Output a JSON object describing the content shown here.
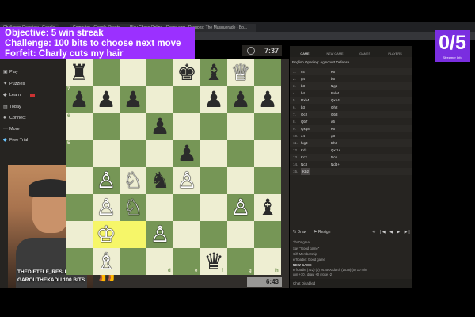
{
  "browser": {
    "tabs": [
      "Challenge Overview - Google",
      "Computer - Google Sheets",
      "Play Chess Online - Chess.com",
      "Dragons: The Masquerade - Bo..."
    ]
  },
  "overlay": {
    "objective": "Objective: 5 win streak",
    "challenge": "Challenge: 100 bits to choose next move",
    "forfeit": "Forfeit: Charly cuts my hair",
    "score": "0/5",
    "score_sub": "Streamer Info"
  },
  "sidebar": {
    "items": [
      {
        "label": "Play",
        "icon": "play-icon"
      },
      {
        "label": "Puzzles",
        "icon": "puzzle-icon"
      },
      {
        "label": "Learn",
        "icon": "learn-icon"
      },
      {
        "label": "Today",
        "icon": "today-icon"
      },
      {
        "label": "Connect",
        "icon": "connect-icon"
      },
      {
        "label": "More",
        "icon": "more-icon"
      },
      {
        "label": "Free Trial",
        "icon": "diamond-icon"
      }
    ]
  },
  "board": {
    "ranks": [
      "7",
      "6",
      "5"
    ],
    "files": [
      "d",
      "e",
      "f",
      "g",
      "h"
    ],
    "clock_top": "7:37",
    "clock_bottom": "6:43"
  },
  "panel": {
    "tabs": [
      "GAME",
      "NEW GAME",
      "GAMES",
      "PLAYERS"
    ],
    "opening": "English Opening: Agincourt Defense",
    "moves": [
      [
        "1.",
        "c4",
        "e6"
      ],
      [
        "2.",
        "g4",
        "b5"
      ],
      [
        "3.",
        "b3",
        "Ng6"
      ],
      [
        "4.",
        "h4",
        "Bxh4"
      ],
      [
        "5.",
        "Rxh4",
        "Qxh4"
      ],
      [
        "6.",
        "b3",
        "Qh2"
      ],
      [
        "7.",
        "Qc2",
        "Qb3"
      ],
      [
        "8.",
        "Qb7",
        "d6"
      ],
      [
        "9.",
        "Qxg8",
        "e6"
      ],
      [
        "10.",
        "e4",
        "g3"
      ],
      [
        "11.",
        "fxg3",
        "Bh3"
      ],
      [
        "12.",
        "Kd1",
        "Qxf1+"
      ],
      [
        "13.",
        "Kc2",
        "Nc6"
      ],
      [
        "14.",
        "Nc3",
        "Nd4+"
      ],
      [
        "15.",
        "Kb2",
        ""
      ]
    ],
    "draw_label": "Draw",
    "resign_label": "Resign",
    "chat": [
      "That's great",
      "Say \"Good game\"",
      "Gift Membership",
      "erfroadie: Good game",
      "NEW GAME",
      "erfroadie (722) (0) vs. BOCdarth (1036) (0) 10 min",
      "win +10 / draw +0 / lose -2"
    ],
    "chat_disabled": "Chat Disabled"
  },
  "webcam": {
    "alert_1": "THEDIETFLF_RESUB X",
    "alert_2": "GAROUTHEKADU 100 BITS"
  }
}
